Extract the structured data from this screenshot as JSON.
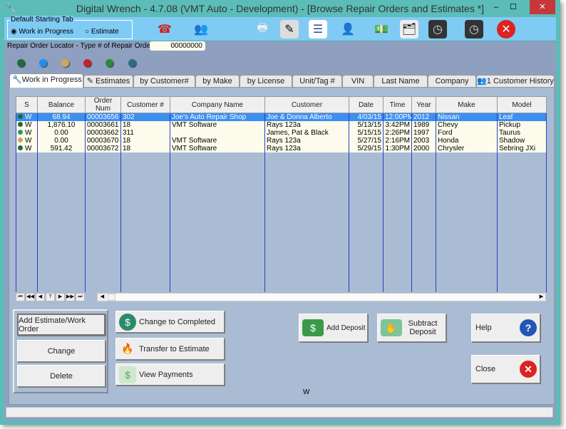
{
  "window": {
    "title": "Digital Wrench - 4.7.08 (VMT Auto - Development) - [Browse Repair Orders and Estimates *]",
    "controls": [
      "–",
      "☐",
      "✕"
    ]
  },
  "toolbar": {
    "default_tab_group": {
      "label": "Default Starting Tab",
      "options": [
        {
          "label": "Work in Progress",
          "selected": true
        },
        {
          "label": "Estimate",
          "selected": false
        }
      ]
    },
    "icons": [
      "phone-computer-icon",
      "customers-icon",
      "printer-icon",
      "document-edit-icon",
      "checklist-icon",
      "technician-icon",
      "money-icon",
      "file-tray-icon",
      "clock-in-icon",
      "clock-out-icon",
      "exit-icon"
    ]
  },
  "locator": {
    "label": "Repair Order Locator - Type # of Repair Order:",
    "value": "00000000"
  },
  "status_colors": [
    "#1f6b3a",
    "#1e8ff0",
    "#d2a55a",
    "#c8202a",
    "#2a8a3c",
    "#2f6a88"
  ],
  "tabs": [
    "Work in Progress",
    "Estimates",
    "by Customer#",
    "by Make",
    "by License",
    "Unit/Tag #",
    "VIN",
    "Last Name",
    "Company",
    "1 Customer History"
  ],
  "grid": {
    "columns": [
      "S",
      "Balance",
      "Order Num",
      "Customer #",
      "Company Name",
      "Customer",
      "Date",
      "Time",
      "Year",
      "Make",
      "Model"
    ],
    "rows": [
      {
        "dot": "#1f6b3a",
        "s": "W",
        "balance": "68.94",
        "order": "00003656",
        "cust": "302",
        "company": "Joe's Auto Repair Shop",
        "customer": "Joe & Donna Alberto",
        "date": "4/03/15",
        "time": "12:00PM",
        "year": "2012",
        "make": "Nissan",
        "model": "Leaf",
        "selected": true
      },
      {
        "dot": "#1f6b3a",
        "s": "W",
        "balance": "1,876.10",
        "order": "00003661",
        "cust": "18",
        "company": "VMT Software",
        "customer": "Rays 123a",
        "date": "5/13/15",
        "time": "3:42PM",
        "year": "1989",
        "make": "Chevy",
        "model": "Pickup"
      },
      {
        "dot": "#2a9a6a",
        "s": "W",
        "balance": "0.00",
        "order": "00003662",
        "cust": "311",
        "company": "",
        "customer": "James, Pat & Black",
        "date": "5/15/15",
        "time": "2:26PM",
        "year": "1997",
        "make": "Ford",
        "model": "Taurus"
      },
      {
        "dot": "#d2a55a",
        "s": "W",
        "balance": "0.00",
        "order": "00003670",
        "cust": "18",
        "company": "VMT Software",
        "customer": "Rays 123a",
        "date": "5/27/15",
        "time": "2:16PM",
        "year": "2003",
        "make": "Honda",
        "model": "Shadow"
      },
      {
        "dot": "#1f6b3a",
        "s": "W",
        "balance": "591.42",
        "order": "00003672",
        "cust": "18",
        "company": "VMT Software",
        "customer": "Rays 123a",
        "date": "5/29/15",
        "time": "1:30PM",
        "year": "2000",
        "make": "Chrysler",
        "model": "Sebring JXi"
      }
    ],
    "nav": [
      "⏮",
      "◀◀",
      "◀",
      "?",
      "▶",
      "▶▶",
      "⏭"
    ]
  },
  "buttons": {
    "add": "Add Estimate/Work Order",
    "change": "Change",
    "delete": "Delete",
    "completed": "Change to Completed",
    "transfer": "Transfer to Estimate",
    "payments": "View Payments",
    "add_deposit": "Add Deposit",
    "subtract_deposit": "Subtract Deposit",
    "help": "Help",
    "close": "Close"
  },
  "status_letter": "W"
}
